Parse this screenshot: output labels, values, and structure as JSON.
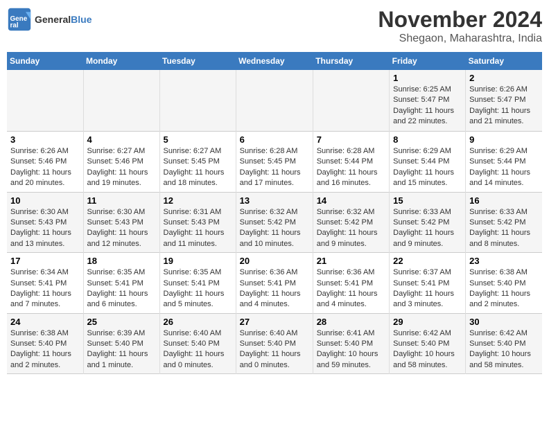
{
  "logo": {
    "text_general": "General",
    "text_blue": "Blue"
  },
  "title": "November 2024",
  "subtitle": "Shegaon, Maharashtra, India",
  "headers": [
    "Sunday",
    "Monday",
    "Tuesday",
    "Wednesday",
    "Thursday",
    "Friday",
    "Saturday"
  ],
  "weeks": [
    {
      "days": [
        {
          "num": "",
          "info": ""
        },
        {
          "num": "",
          "info": ""
        },
        {
          "num": "",
          "info": ""
        },
        {
          "num": "",
          "info": ""
        },
        {
          "num": "",
          "info": ""
        },
        {
          "num": "1",
          "info": "Sunrise: 6:25 AM\nSunset: 5:47 PM\nDaylight: 11 hours\nand 22 minutes."
        },
        {
          "num": "2",
          "info": "Sunrise: 6:26 AM\nSunset: 5:47 PM\nDaylight: 11 hours\nand 21 minutes."
        }
      ]
    },
    {
      "days": [
        {
          "num": "3",
          "info": "Sunrise: 6:26 AM\nSunset: 5:46 PM\nDaylight: 11 hours\nand 20 minutes."
        },
        {
          "num": "4",
          "info": "Sunrise: 6:27 AM\nSunset: 5:46 PM\nDaylight: 11 hours\nand 19 minutes."
        },
        {
          "num": "5",
          "info": "Sunrise: 6:27 AM\nSunset: 5:45 PM\nDaylight: 11 hours\nand 18 minutes."
        },
        {
          "num": "6",
          "info": "Sunrise: 6:28 AM\nSunset: 5:45 PM\nDaylight: 11 hours\nand 17 minutes."
        },
        {
          "num": "7",
          "info": "Sunrise: 6:28 AM\nSunset: 5:44 PM\nDaylight: 11 hours\nand 16 minutes."
        },
        {
          "num": "8",
          "info": "Sunrise: 6:29 AM\nSunset: 5:44 PM\nDaylight: 11 hours\nand 15 minutes."
        },
        {
          "num": "9",
          "info": "Sunrise: 6:29 AM\nSunset: 5:44 PM\nDaylight: 11 hours\nand 14 minutes."
        }
      ]
    },
    {
      "days": [
        {
          "num": "10",
          "info": "Sunrise: 6:30 AM\nSunset: 5:43 PM\nDaylight: 11 hours\nand 13 minutes."
        },
        {
          "num": "11",
          "info": "Sunrise: 6:30 AM\nSunset: 5:43 PM\nDaylight: 11 hours\nand 12 minutes."
        },
        {
          "num": "12",
          "info": "Sunrise: 6:31 AM\nSunset: 5:43 PM\nDaylight: 11 hours\nand 11 minutes."
        },
        {
          "num": "13",
          "info": "Sunrise: 6:32 AM\nSunset: 5:42 PM\nDaylight: 11 hours\nand 10 minutes."
        },
        {
          "num": "14",
          "info": "Sunrise: 6:32 AM\nSunset: 5:42 PM\nDaylight: 11 hours\nand 9 minutes."
        },
        {
          "num": "15",
          "info": "Sunrise: 6:33 AM\nSunset: 5:42 PM\nDaylight: 11 hours\nand 9 minutes."
        },
        {
          "num": "16",
          "info": "Sunrise: 6:33 AM\nSunset: 5:42 PM\nDaylight: 11 hours\nand 8 minutes."
        }
      ]
    },
    {
      "days": [
        {
          "num": "17",
          "info": "Sunrise: 6:34 AM\nSunset: 5:41 PM\nDaylight: 11 hours\nand 7 minutes."
        },
        {
          "num": "18",
          "info": "Sunrise: 6:35 AM\nSunset: 5:41 PM\nDaylight: 11 hours\nand 6 minutes."
        },
        {
          "num": "19",
          "info": "Sunrise: 6:35 AM\nSunset: 5:41 PM\nDaylight: 11 hours\nand 5 minutes."
        },
        {
          "num": "20",
          "info": "Sunrise: 6:36 AM\nSunset: 5:41 PM\nDaylight: 11 hours\nand 4 minutes."
        },
        {
          "num": "21",
          "info": "Sunrise: 6:36 AM\nSunset: 5:41 PM\nDaylight: 11 hours\nand 4 minutes."
        },
        {
          "num": "22",
          "info": "Sunrise: 6:37 AM\nSunset: 5:41 PM\nDaylight: 11 hours\nand 3 minutes."
        },
        {
          "num": "23",
          "info": "Sunrise: 6:38 AM\nSunset: 5:40 PM\nDaylight: 11 hours\nand 2 minutes."
        }
      ]
    },
    {
      "days": [
        {
          "num": "24",
          "info": "Sunrise: 6:38 AM\nSunset: 5:40 PM\nDaylight: 11 hours\nand 2 minutes."
        },
        {
          "num": "25",
          "info": "Sunrise: 6:39 AM\nSunset: 5:40 PM\nDaylight: 11 hours\nand 1 minute."
        },
        {
          "num": "26",
          "info": "Sunrise: 6:40 AM\nSunset: 5:40 PM\nDaylight: 11 hours\nand 0 minutes."
        },
        {
          "num": "27",
          "info": "Sunrise: 6:40 AM\nSunset: 5:40 PM\nDaylight: 11 hours\nand 0 minutes."
        },
        {
          "num": "28",
          "info": "Sunrise: 6:41 AM\nSunset: 5:40 PM\nDaylight: 10 hours\nand 59 minutes."
        },
        {
          "num": "29",
          "info": "Sunrise: 6:42 AM\nSunset: 5:40 PM\nDaylight: 10 hours\nand 58 minutes."
        },
        {
          "num": "30",
          "info": "Sunrise: 6:42 AM\nSunset: 5:40 PM\nDaylight: 10 hours\nand 58 minutes."
        }
      ]
    }
  ]
}
